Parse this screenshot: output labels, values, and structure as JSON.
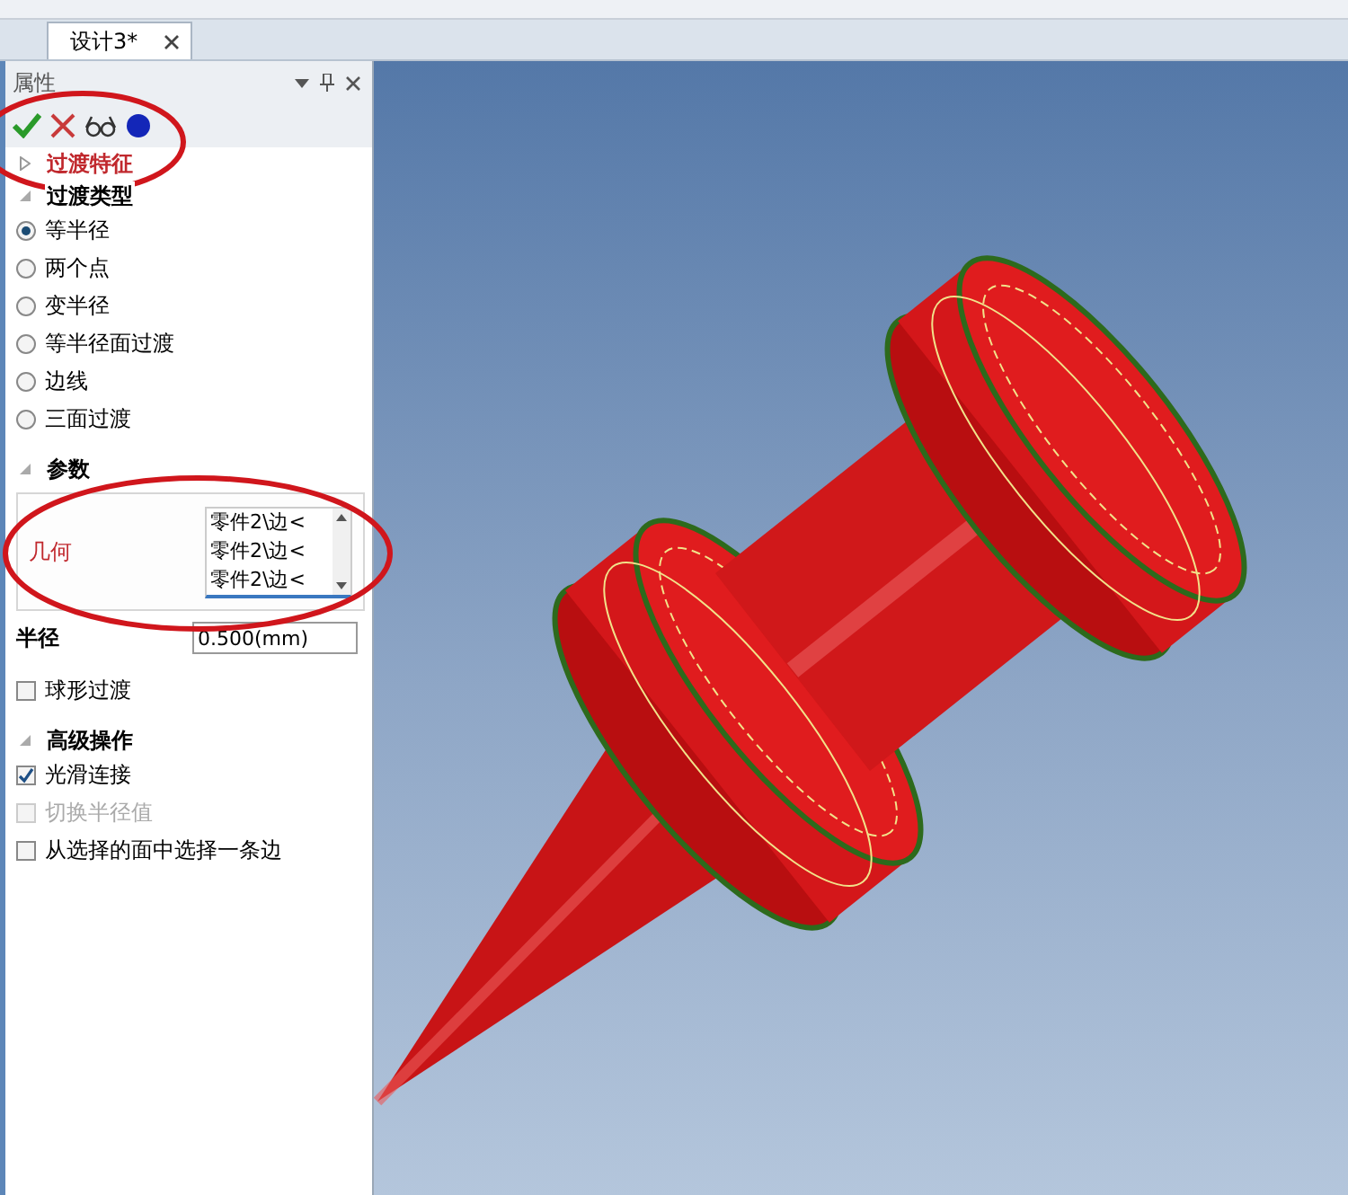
{
  "tab": {
    "label": "设计3*",
    "selected": true
  },
  "panel": {
    "title": "属性",
    "feature": {
      "label": "过渡特征",
      "expanded": false
    },
    "fillet_type": {
      "title": "过渡类型",
      "expanded": true,
      "options": [
        {
          "label": "等半径",
          "selected": true
        },
        {
          "label": "两个点",
          "selected": false
        },
        {
          "label": "变半径",
          "selected": false
        },
        {
          "label": "等半径面过渡",
          "selected": false
        },
        {
          "label": "边线",
          "selected": false
        },
        {
          "label": "三面过渡",
          "selected": false
        }
      ]
    },
    "parameters": {
      "title": "参数",
      "expanded": true,
      "geometry": {
        "label": "几何",
        "items": [
          "零件2\\边<",
          "零件2\\边<",
          "零件2\\边<"
        ]
      },
      "radius": {
        "label": "半径",
        "value": "0.500(mm)"
      },
      "spherical": {
        "label": "球形过渡",
        "checked": false,
        "disabled": false
      }
    },
    "advanced": {
      "title": "高级操作",
      "expanded": true,
      "options": [
        {
          "label": "光滑连接",
          "checked": true,
          "disabled": false
        },
        {
          "label": "切换半径值",
          "checked": false,
          "disabled": true
        },
        {
          "label": "从选择的面中选择一条边",
          "checked": false,
          "disabled": false
        }
      ]
    }
  }
}
